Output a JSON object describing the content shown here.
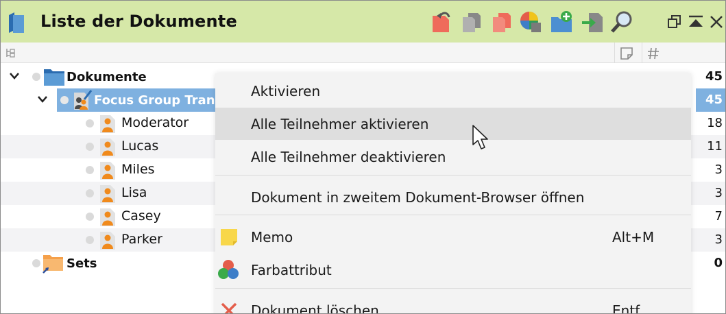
{
  "window": {
    "title": "Liste der Dokumente"
  },
  "toolbar": {
    "icons": [
      "activate-icon",
      "copy-icon",
      "documents-icon",
      "color-wheel-icon",
      "new-folder-icon",
      "import-icon",
      "search-icon"
    ],
    "window_buttons": [
      "restore-icon",
      "collapse-icon",
      "close-icon"
    ]
  },
  "column_header": {
    "icons": [
      "tree-icon",
      "memo-column-icon",
      "number-column-icon"
    ]
  },
  "tree": {
    "root": {
      "label": "Dokumente",
      "count": "45"
    },
    "group": {
      "label": "Focus Group Transcript",
      "count": "45"
    },
    "items": [
      {
        "label": "Moderator",
        "count": "18"
      },
      {
        "label": "Lucas",
        "count": "11"
      },
      {
        "label": "Miles",
        "count": "3"
      },
      {
        "label": "Lisa",
        "count": "3"
      },
      {
        "label": "Casey",
        "count": "7"
      },
      {
        "label": "Parker",
        "count": "3"
      }
    ],
    "sets": {
      "label": "Sets",
      "count": "0"
    }
  },
  "context_menu": {
    "items": [
      {
        "label": "Aktivieren"
      },
      {
        "label": "Alle Teilnehmer aktivieren"
      },
      {
        "label": "Alle Teilnehmer deaktivieren"
      },
      {
        "label": "Dokument in zweitem Dokument-Browser öffnen"
      },
      {
        "label": "Memo",
        "shortcut": "Alt+M",
        "icon": "memo-icon"
      },
      {
        "label": "Farbattribut",
        "icon": "color-attribute-icon"
      },
      {
        "label": "Dokument löschen",
        "shortcut": "Entf",
        "icon": "delete-icon"
      }
    ],
    "hovered_index": 1
  },
  "colors": {
    "titlebar": "#d6e8a8",
    "selection": "#7fb1e0",
    "menu_bg": "#f3f3f3",
    "menu_hover": "#dedede",
    "person_orange": "#f08a1c"
  }
}
